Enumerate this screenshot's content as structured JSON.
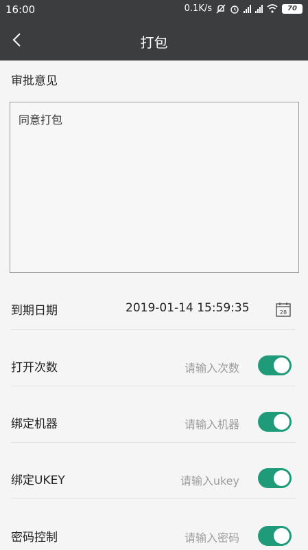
{
  "status_bar": {
    "time": "16:00",
    "net_speed": "0.1K/s",
    "battery": "70"
  },
  "header": {
    "title": "打包"
  },
  "approval": {
    "label": "审批意见",
    "comment": "同意打包"
  },
  "expiry": {
    "label": "到期日期",
    "value": "2019-01-14 15:59:35",
    "calendar_day": "28"
  },
  "settings": [
    {
      "label": "打开次数",
      "placeholder": "请输入次数",
      "enabled": true
    },
    {
      "label": "绑定机器",
      "placeholder": "请输入机器",
      "enabled": true
    },
    {
      "label": "绑定UKEY",
      "placeholder": "请输入ukey",
      "enabled": true
    },
    {
      "label": "密码控制",
      "placeholder": "请输入密码",
      "enabled": true
    }
  ],
  "colors": {
    "header_bg": "#3b3d3f",
    "toggle_on": "#1f9b79",
    "page_bg": "#f5f5f5"
  }
}
